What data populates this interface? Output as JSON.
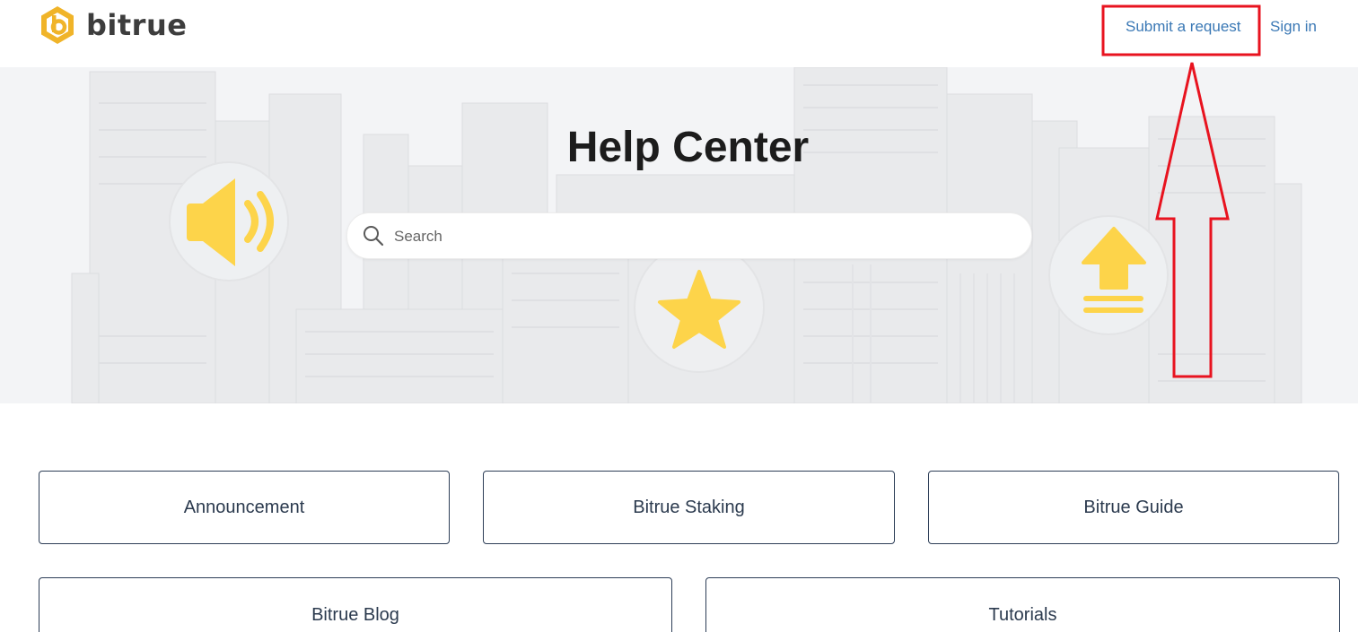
{
  "header": {
    "logo_text": "bitrue",
    "submit_request_label": "Submit a request",
    "sign_in_label": "Sign in"
  },
  "hero": {
    "title": "Help Center",
    "search_placeholder": "Search"
  },
  "categories": [
    {
      "label": "Announcement"
    },
    {
      "label": "Bitrue Staking"
    },
    {
      "label": "Bitrue Guide"
    },
    {
      "label": "Bitrue Blog"
    },
    {
      "label": "Tutorials"
    }
  ],
  "icons": {
    "logo": "bitrue-logo-icon",
    "search": "search-icon",
    "hero_left": "speaker-icon",
    "hero_center": "star-icon",
    "hero_right": "upload-arrow-icon"
  },
  "colors": {
    "brand": "#f0b429",
    "link": "#3a78b5",
    "annotation": "#e8131f",
    "card_border": "#2d3e57",
    "icon_yellow": "#fdd44a"
  }
}
